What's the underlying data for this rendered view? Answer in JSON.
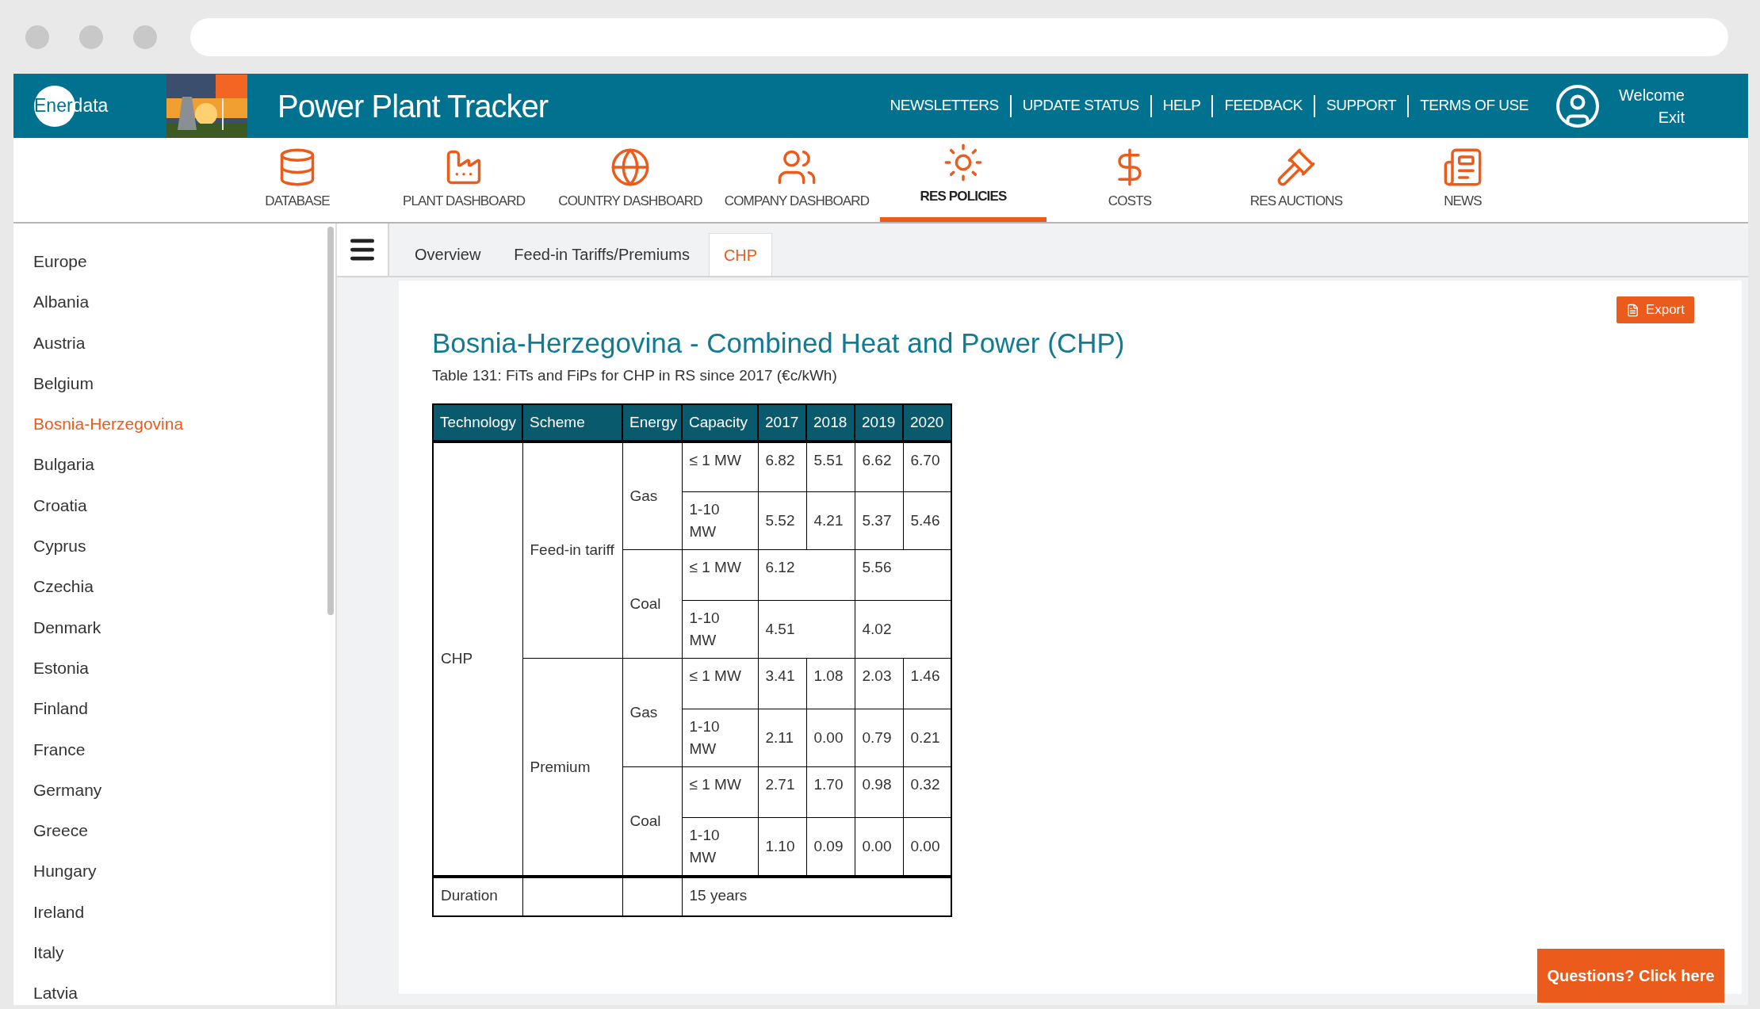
{
  "header": {
    "logo": {
      "part1": "Ener",
      "part2": "data"
    },
    "title": "Power Plant Tracker",
    "links": [
      "NEWSLETTERS",
      "UPDATE STATUS",
      "HELP",
      "FEEDBACK",
      "SUPPORT",
      "TERMS OF USE"
    ],
    "welcome": "Welcome",
    "exit": "Exit"
  },
  "nav": [
    {
      "kind": "database",
      "label": "DATABASE",
      "selected": false
    },
    {
      "kind": "plant",
      "label": "PLANT DASHBOARD",
      "selected": false
    },
    {
      "kind": "country",
      "label": "COUNTRY DASHBOARD",
      "selected": false
    },
    {
      "kind": "company",
      "label": "COMPANY DASHBOARD",
      "selected": false
    },
    {
      "kind": "policies",
      "label": "RES POLICIES",
      "selected": true
    },
    {
      "kind": "costs",
      "label": "COSTS",
      "selected": false
    },
    {
      "kind": "auctions",
      "label": "RES AUCTIONS",
      "selected": false
    },
    {
      "kind": "news",
      "label": "NEWS",
      "selected": false
    }
  ],
  "sidebar": {
    "items": [
      {
        "label": "Europe",
        "selected": false
      },
      {
        "label": "Albania",
        "selected": false
      },
      {
        "label": "Austria",
        "selected": false
      },
      {
        "label": "Belgium",
        "selected": false
      },
      {
        "label": "Bosnia-Herzegovina",
        "selected": true
      },
      {
        "label": "Bulgaria",
        "selected": false
      },
      {
        "label": "Croatia",
        "selected": false
      },
      {
        "label": "Cyprus",
        "selected": false
      },
      {
        "label": "Czechia",
        "selected": false
      },
      {
        "label": "Denmark",
        "selected": false
      },
      {
        "label": "Estonia",
        "selected": false
      },
      {
        "label": "Finland",
        "selected": false
      },
      {
        "label": "France",
        "selected": false
      },
      {
        "label": "Germany",
        "selected": false
      },
      {
        "label": "Greece",
        "selected": false
      },
      {
        "label": "Hungary",
        "selected": false
      },
      {
        "label": "Ireland",
        "selected": false
      },
      {
        "label": "Italy",
        "selected": false
      },
      {
        "label": "Latvia",
        "selected": false
      }
    ]
  },
  "tabs": [
    {
      "label": "Overview",
      "selected": false
    },
    {
      "label": "Feed-in Tariffs/Premiums",
      "selected": false
    },
    {
      "label": "CHP",
      "selected": true
    }
  ],
  "export_button": "Export",
  "title": "Bosnia-Herzegovina - Combined Heat and Power (CHP)",
  "caption": "Table 131: FiTs and FiPs for CHP in RS since 2017 (€c/kWh)",
  "table": {
    "columns": [
      "Technology",
      "Scheme",
      "Energy",
      "Capacity",
      "2017",
      "2018",
      "2019",
      "2020"
    ],
    "technology": "CHP",
    "schemes": [
      {
        "name": "Feed-in tariff",
        "energies": [
          {
            "name": "Gas",
            "capacities": [
              {
                "label": "≤ 1 MW",
                "values": [
                  "6.82",
                  "5.51",
                  "6.62",
                  "6.70"
                ]
              },
              {
                "label": "1-10 MW",
                "values": [
                  "5.52",
                  "4.21",
                  "5.37",
                  "5.46"
                ]
              }
            ]
          },
          {
            "name": "Coal",
            "capacities": [
              {
                "label": "≤ 1 MW",
                "values": [
                  "6.12",
                  "5.56"
                ]
              },
              {
                "label": "1-10 MW",
                "values": [
                  "4.51",
                  "4.02"
                ]
              }
            ]
          }
        ]
      },
      {
        "name": "Premium",
        "energies": [
          {
            "name": "Gas",
            "capacities": [
              {
                "label": "≤ 1 MW",
                "values": [
                  "3.41",
                  "1.08",
                  "2.03",
                  "1.46"
                ]
              },
              {
                "label": "1-10 MW",
                "values": [
                  "2.11",
                  "0.00",
                  "0.79",
                  "0.21"
                ]
              }
            ]
          },
          {
            "name": "Coal",
            "capacities": [
              {
                "label": "≤ 1 MW",
                "values": [
                  "2.71",
                  "1.70",
                  "0.98",
                  "0.32"
                ]
              },
              {
                "label": "1-10 MW",
                "values": [
                  "1.10",
                  "0.09",
                  "0.00",
                  "0.00"
                ]
              }
            ]
          }
        ]
      }
    ],
    "duration": {
      "label": "Duration",
      "value": "15 years"
    }
  },
  "help_button": "Questions? Click here"
}
